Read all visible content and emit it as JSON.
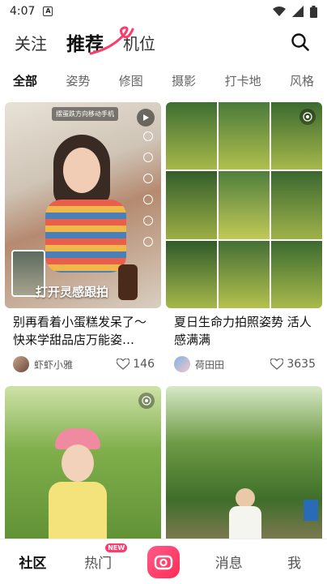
{
  "status_bar": {
    "time": "4:07",
    "app_badge": "A"
  },
  "top_nav": {
    "tabs": [
      {
        "label": "关注"
      },
      {
        "label": "推荐"
      },
      {
        "label": "机位"
      }
    ],
    "active_index": 1
  },
  "category_tabs": [
    "全部",
    "姿势",
    "修图",
    "摄影",
    "打卡地",
    "风格"
  ],
  "cards": [
    {
      "title": "别再看着小蛋糕发呆了～快来学甜品店万能姿…",
      "author": "虾虾小雅",
      "likes": "146",
      "overlay_label": "打开灵感跟拍",
      "top_banner": "摆蛋跌方向移动手机"
    },
    {
      "title": "夏日生命力拍照姿势 活人感满满",
      "author": "荷田田",
      "likes": "3635"
    },
    {
      "title": "",
      "author": "",
      "likes": ""
    },
    {
      "title": "",
      "author": "",
      "likes": ""
    }
  ],
  "bottom_nav": {
    "items": [
      {
        "label": "社区"
      },
      {
        "label": "热门",
        "badge": "NEW"
      },
      {
        "label": ""
      },
      {
        "label": "消息"
      },
      {
        "label": "我"
      }
    ]
  },
  "colors": {
    "accent": "#ff2d55",
    "swoosh": "#ff3b6b"
  }
}
